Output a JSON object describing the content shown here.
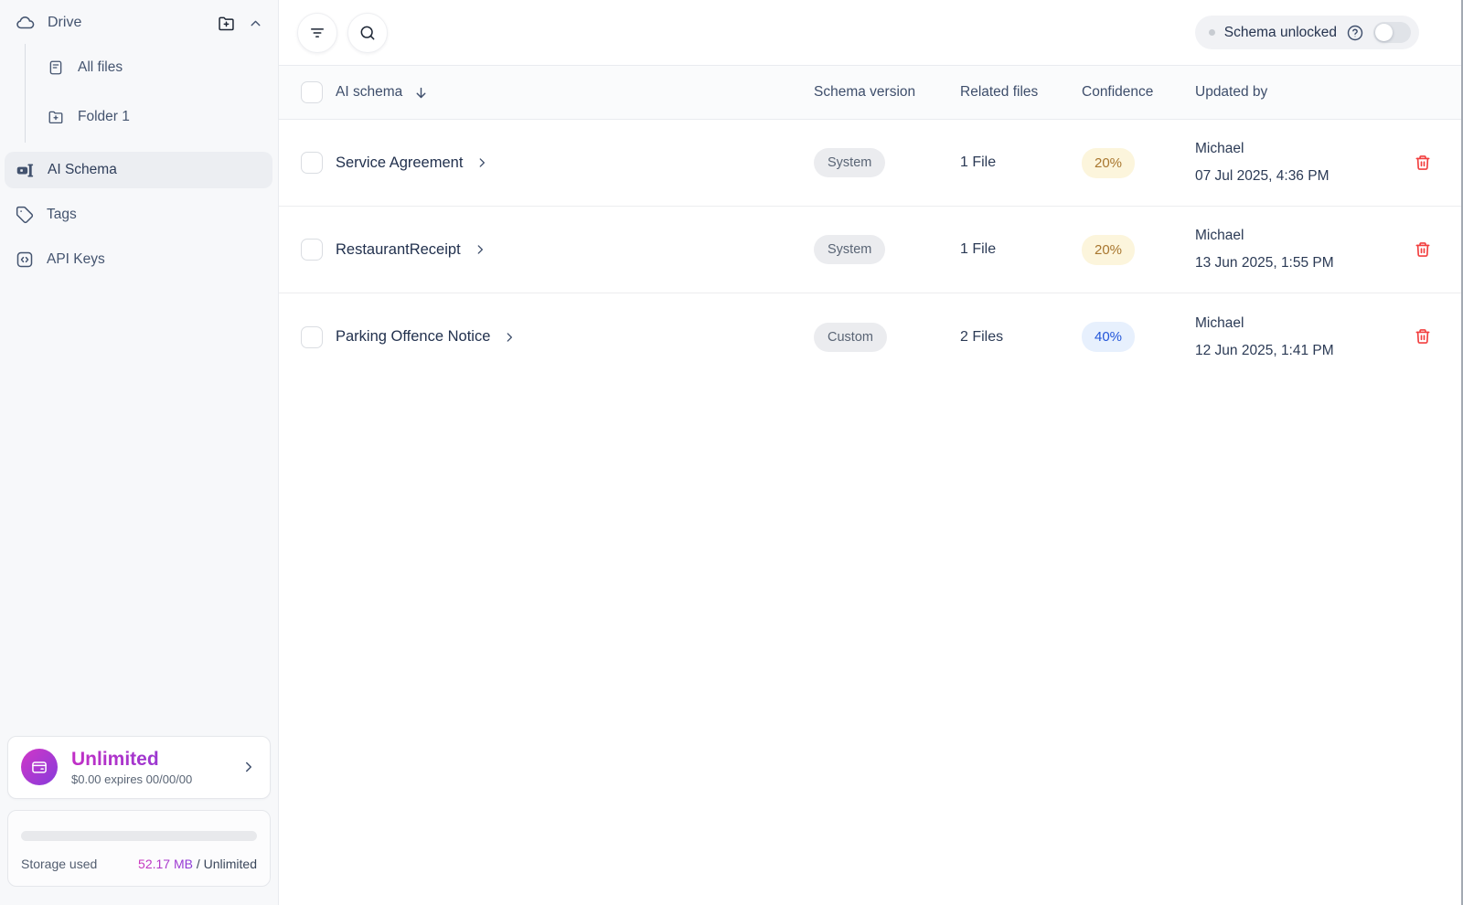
{
  "sidebar": {
    "drive": {
      "label": "Drive"
    },
    "tree_items": [
      {
        "label": "All files"
      },
      {
        "label": "Folder 1"
      }
    ],
    "nav_items": [
      {
        "label": "AI Schema"
      },
      {
        "label": "Tags"
      },
      {
        "label": "API Keys"
      }
    ],
    "plan_card": {
      "title": "Unlimited",
      "subtitle": "$0.00 expires 00/00/00"
    },
    "storage_card": {
      "label": "Storage used",
      "used": "52.17 MB",
      "rest": " / Unlimited"
    }
  },
  "toolbar": {
    "schema_toggle": {
      "label": "Schema unlocked",
      "state": "off"
    }
  },
  "table": {
    "header": {
      "name": "AI schema",
      "schema_version": "Schema version",
      "related_files": "Related files",
      "confidence": "Confidence",
      "updated_by": "Updated by"
    },
    "rows": [
      {
        "name": "Service Agreement",
        "schema_version": "System",
        "related_files": "1 File",
        "confidence": "20%",
        "confidence_type": "yellow",
        "updated_by_name": "Michael",
        "updated_by_date": "07 Jul 2025, 4:36 PM"
      },
      {
        "name": "RestaurantReceipt",
        "schema_version": "System",
        "related_files": "1 File",
        "confidence": "20%",
        "confidence_type": "yellow",
        "updated_by_name": "Michael",
        "updated_by_date": "13 Jun 2025, 1:55 PM"
      },
      {
        "name": "Parking Offence Notice",
        "schema_version": "Custom",
        "related_files": "2 Files",
        "confidence": "40%",
        "confidence_type": "blue",
        "updated_by_name": "Michael",
        "updated_by_date": "12 Jun 2025, 1:41 PM"
      }
    ]
  },
  "colors": {
    "accent_magenta": "#C12FC6",
    "accent_purple": "#7E3FD8",
    "confidence_yellow_bg": "#FCF5DC",
    "confidence_yellow_text": "#A8762E",
    "confidence_blue_bg": "#E7F0FD",
    "confidence_blue_text": "#2356D9",
    "danger_red": "#F23F3F",
    "sidebar_bg": "#F7F8FA",
    "active_item_bg": "#ECEEF2"
  }
}
